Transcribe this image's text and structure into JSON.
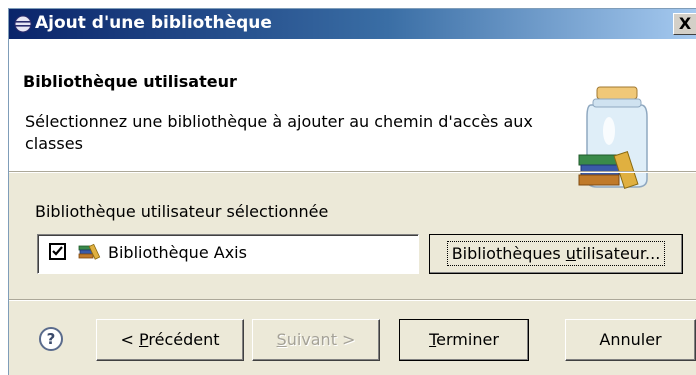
{
  "window": {
    "title": "Ajout d'une bibliothèque",
    "close_label": "X"
  },
  "header": {
    "title": "Bibliothèque utilisateur",
    "description": "Sélectionnez une bibliothèque à ajouter au chemin d'accès aux classes"
  },
  "selection": {
    "group_label": "Bibliothèque utilisateur sélectionnée",
    "items": [
      {
        "label": "Bibliothèque Axis",
        "checked": true
      }
    ]
  },
  "buttons": {
    "user_libraries": {
      "before": "Bibliothèques ",
      "mnemonic": "u",
      "after": "tilisateur..."
    },
    "previous": {
      "before": "< ",
      "mnemonic": "P",
      "after": "récédent"
    },
    "next": {
      "before": "",
      "mnemonic": "S",
      "after": "uivant >"
    },
    "finish": {
      "before": "",
      "mnemonic": "T",
      "after": "erminer"
    },
    "cancel": "Annuler",
    "help": "?"
  },
  "state": {
    "next_enabled": false
  },
  "colors": {
    "title_gradient_start": "#0a246a",
    "title_gradient_end": "#a6caf0",
    "dialog_background": "#ece9d8",
    "disabled_text": "#a5a297"
  }
}
